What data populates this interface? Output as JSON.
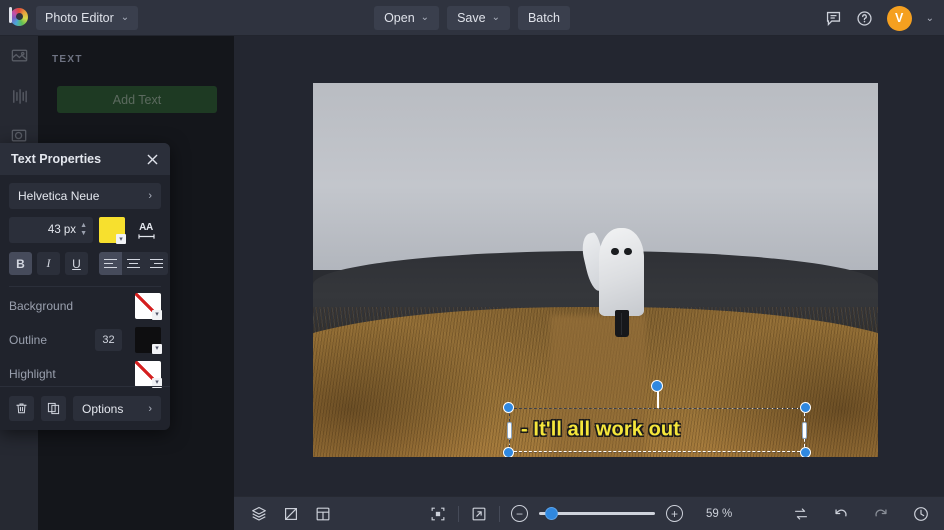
{
  "topbar": {
    "logo_icon": "bannerbear-logo-icon",
    "app_menu_label": "Photo Editor",
    "app_menu_caret": "⌄",
    "buttons": [
      {
        "label": "Open",
        "caret": "⌄",
        "name": "open-button"
      },
      {
        "label": "Save",
        "caret": "⌄",
        "name": "save-button"
      },
      {
        "label": "Batch",
        "caret": "",
        "name": "batch-button"
      }
    ],
    "comment_icon": "comment-icon",
    "help_icon": "help-icon",
    "avatar_initial": "V",
    "avatar_caret": "⌄"
  },
  "rail": {
    "items": [
      {
        "name": "sidebar-item-image",
        "icon": "image-icon"
      },
      {
        "name": "sidebar-item-adjust",
        "icon": "sliders-icon"
      },
      {
        "name": "sidebar-item-effects",
        "icon": "effects-icon"
      }
    ]
  },
  "text_panel": {
    "section_label": "TEXT",
    "add_text_label": "Add Text"
  },
  "canvas": {
    "text_object": {
      "content": "- It'll all work out",
      "color": "#f5e63b",
      "outline_color": "#1b1b1b"
    },
    "photo_alt": "person in white ghost sheet standing on a grassy hill path"
  },
  "text_properties": {
    "title": "Text Properties",
    "close_icon": "close-icon",
    "font_family": "Helvetica Neue",
    "font_family_chevron": "›",
    "font_size": "43 px",
    "spin_up": "▲",
    "spin_down": "▼",
    "fill_color": "#f7e02e",
    "fill_swatch_name": "fill-color-swatch",
    "letter_spacing_icon": "letter-spacing-icon",
    "letter_spacing_label": "AA",
    "format": {
      "bold": {
        "label": "B",
        "active": true,
        "name": "bold-button"
      },
      "italic": {
        "label": "I",
        "active": false,
        "name": "italic-button"
      },
      "underline": {
        "label": "U",
        "active": false,
        "name": "underline-button"
      }
    },
    "align": {
      "left": {
        "active": true,
        "name": "align-left-button"
      },
      "center": {
        "active": false,
        "name": "align-center-button"
      },
      "right": {
        "active": false,
        "name": "align-right-button"
      }
    },
    "rows": [
      {
        "label": "Background",
        "value": "",
        "swatch": "none",
        "swatch_name": "background-color-swatch"
      },
      {
        "label": "Outline",
        "value": "32",
        "swatch": "black",
        "swatch_name": "outline-color-swatch"
      },
      {
        "label": "Highlight",
        "value": "",
        "swatch": "none",
        "swatch_name": "highlight-color-swatch"
      }
    ],
    "footer": {
      "delete_icon": "trash-icon",
      "duplicate_icon": "duplicate-icon",
      "options_label": "Options",
      "options_chevron": "›"
    }
  },
  "bottombar": {
    "layers_icon": "layers-icon",
    "crop_icon": "crop-icon",
    "grid_icon": "grid-icon",
    "fit_icon": "fit-to-screen-icon",
    "expand_icon": "fullscreen-icon",
    "zoom_out_label": "−",
    "zoom_in_label": "+",
    "zoom_value": "59 %",
    "swap_icon": "compare-icon",
    "undo_icon": "undo-icon",
    "redo_icon": "redo-icon",
    "history_icon": "history-icon"
  }
}
